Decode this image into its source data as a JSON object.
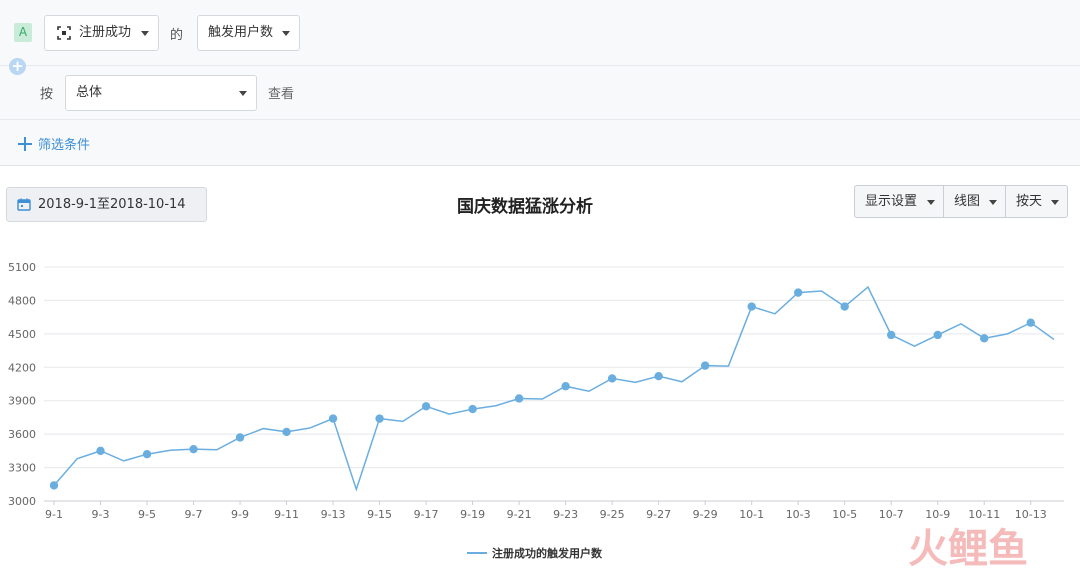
{
  "query": {
    "tag": "A",
    "event_label": "注册成功",
    "connector": "的",
    "metric_label": "触发用户数",
    "by_label": "按",
    "group_label": "总体",
    "view_label": "查看",
    "filter_label": "筛选条件"
  },
  "toolbar": {
    "date_range": "2018-9-1至2018-10-14",
    "display_settings": "显示设置",
    "chart_type": "线图",
    "granularity": "按天"
  },
  "colors": {
    "line": "#6aaee0",
    "grid": "#e5e8ec",
    "accent": "#3d8fd6",
    "watermark": "#f4b0b0"
  },
  "chart_data": {
    "type": "line",
    "title": "国庆数据猛涨分析",
    "xlabel": "",
    "ylabel": "",
    "ylim": [
      3000,
      5100
    ],
    "yticks": [
      3000,
      3300,
      3600,
      3900,
      4200,
      4500,
      4800,
      5100
    ],
    "grid": true,
    "legend_position": "bottom-center",
    "categories": [
      "9-1",
      "9-2",
      "9-3",
      "9-4",
      "9-5",
      "9-6",
      "9-7",
      "9-8",
      "9-9",
      "9-10",
      "9-11",
      "9-12",
      "9-13",
      "9-14",
      "9-15",
      "9-16",
      "9-17",
      "9-18",
      "9-19",
      "9-20",
      "9-21",
      "9-22",
      "9-23",
      "9-24",
      "9-25",
      "9-26",
      "9-27",
      "9-28",
      "9-29",
      "9-30",
      "10-1",
      "10-2",
      "10-3",
      "10-4",
      "10-5",
      "10-6",
      "10-7",
      "10-8",
      "10-9",
      "10-10",
      "10-11",
      "10-12",
      "10-13",
      "10-14"
    ],
    "xtick_labels": [
      "9-1",
      "9-3",
      "9-5",
      "9-7",
      "9-9",
      "9-11",
      "9-13",
      "9-15",
      "9-17",
      "9-19",
      "9-21",
      "9-23",
      "9-25",
      "9-27",
      "9-29",
      "10-1",
      "10-3",
      "10-5",
      "10-7",
      "10-9",
      "10-11",
      "10-13"
    ],
    "series": [
      {
        "name": "注册成功的触发用户数",
        "values": [
          3140,
          3380,
          3450,
          3360,
          3420,
          3455,
          3465,
          3460,
          3570,
          3650,
          3620,
          3655,
          3740,
          3105,
          3740,
          3715,
          3850,
          3780,
          3825,
          3855,
          3920,
          3915,
          4030,
          3985,
          4100,
          4065,
          4120,
          4070,
          4215,
          4210,
          4745,
          4680,
          4870,
          4885,
          4745,
          4920,
          4490,
          4390,
          4490,
          4590,
          4460,
          4500,
          4600,
          4450
        ]
      }
    ]
  },
  "watermark": {
    "text": "火鲤鱼"
  }
}
